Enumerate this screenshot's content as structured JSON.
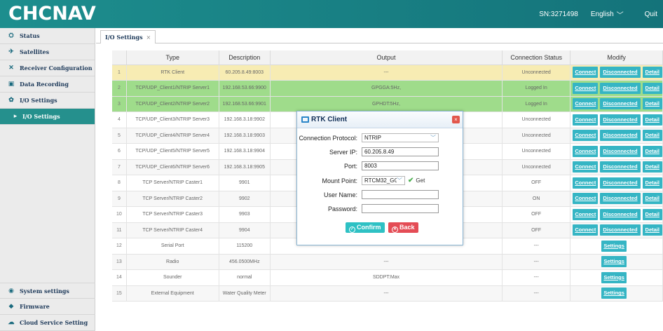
{
  "header": {
    "logo": "CHCNAV",
    "sn": "SN:3271498",
    "language": "English",
    "quit": "Quit",
    "colors": {
      "bar": "#1d8e8e"
    }
  },
  "sidebar": {
    "items": [
      {
        "label": "Status",
        "icon": "status-icon"
      },
      {
        "label": "Satellites",
        "icon": "satellite-icon"
      },
      {
        "label": "Receiver Configuration",
        "icon": "tools-icon"
      },
      {
        "label": "Data Recording",
        "icon": "recording-icon"
      },
      {
        "label": "I/O Settings",
        "icon": "gear-icon"
      },
      {
        "label": "I/O Settings",
        "icon": "arrow-right-icon",
        "active": true
      }
    ],
    "bottom_items": [
      {
        "label": "System settings",
        "icon": "wifi-icon"
      },
      {
        "label": "Firmware",
        "icon": "firmware-icon"
      },
      {
        "label": "Cloud Service Setting",
        "icon": "cloud-icon"
      }
    ]
  },
  "tabs": [
    {
      "label": "I/O Settings",
      "close": "×"
    }
  ],
  "table": {
    "headers": [
      "Type",
      "Description",
      "Output",
      "Connection Status",
      "Modify"
    ],
    "rows": [
      {
        "idx": "1",
        "type": "RTK Client",
        "desc": "60.205.8.49:8003",
        "output": "---",
        "status": "Unconnected",
        "style": "yellow",
        "buttons": [
          "Connect",
          "Disconnected",
          "Detail"
        ]
      },
      {
        "idx": "2",
        "type": "TCP/UDP_Client1/NTRIP Server1",
        "desc": "192.168.53.66:9900",
        "output": "GPGGA:5Hz,",
        "status": "Logged In",
        "style": "green",
        "buttons": [
          "Connect",
          "Disconnected",
          "Detail"
        ]
      },
      {
        "idx": "3",
        "type": "TCP/UDP_Client2/NTRIP Server2",
        "desc": "192.168.53.66:9901",
        "output": "GPHDT:5Hz,",
        "status": "Logged In",
        "style": "green",
        "buttons": [
          "Connect",
          "Disconnected",
          "Detail"
        ]
      },
      {
        "idx": "4",
        "type": "TCP/UDP_Client3/NTRIP Server3",
        "desc": "192.168.3.18:9902",
        "output": "",
        "status": "Unconnected",
        "style": "white",
        "buttons": [
          "Connect",
          "Disconnected",
          "Detail"
        ]
      },
      {
        "idx": "5",
        "type": "TCP/UDP_Client4/NTRIP Server4",
        "desc": "192.168.3.18:9903",
        "output": "",
        "status": "Unconnected",
        "style": "alt",
        "buttons": [
          "Connect",
          "Disconnected",
          "Detail"
        ]
      },
      {
        "idx": "6",
        "type": "TCP/UDP_Client5/NTRIP Server5",
        "desc": "192.168.3.18:9904",
        "output": "",
        "status": "Unconnected",
        "style": "white",
        "buttons": [
          "Connect",
          "Disconnected",
          "Detail"
        ]
      },
      {
        "idx": "7",
        "type": "TCP/UDP_Client6/NTRIP Server6",
        "desc": "192.168.3.18:9905",
        "output": "",
        "status": "Unconnected",
        "style": "alt",
        "buttons": [
          "Connect",
          "Disconnected",
          "Detail"
        ]
      },
      {
        "idx": "8",
        "type": "TCP Server/NTRIP Caster1",
        "desc": "9901",
        "output": "",
        "status": "OFF",
        "style": "white",
        "buttons": [
          "Connect",
          "Disconnected",
          "Detail"
        ]
      },
      {
        "idx": "9",
        "type": "TCP Server/NTRIP Caster2",
        "desc": "9902",
        "output": "",
        "status": "ON",
        "style": "alt",
        "buttons": [
          "Connect",
          "Disconnected",
          "Detail"
        ]
      },
      {
        "idx": "10",
        "type": "TCP Server/NTRIP Caster3",
        "desc": "9903",
        "output": "",
        "status": "OFF",
        "style": "white",
        "buttons": [
          "Connect",
          "Disconnected",
          "Detail"
        ]
      },
      {
        "idx": "11",
        "type": "TCP Server/NTRIP Caster4",
        "desc": "9904",
        "output": "",
        "status": "OFF",
        "style": "alt",
        "buttons": [
          "Connect",
          "Disconnected",
          "Detail"
        ]
      },
      {
        "idx": "12",
        "type": "Serial Port",
        "desc": "115200",
        "output": "",
        "status": "---",
        "style": "white",
        "buttons": [
          "Settings"
        ]
      },
      {
        "idx": "13",
        "type": "Radio",
        "desc": "456.0500MHz",
        "output": "---",
        "status": "---",
        "style": "alt",
        "buttons": [
          "Settings"
        ]
      },
      {
        "idx": "14",
        "type": "Sounder",
        "desc": "normal",
        "output": "SDDPT:Max",
        "status": "---",
        "style": "white",
        "buttons": [
          "Settings"
        ]
      },
      {
        "idx": "15",
        "type": "External Equipment",
        "desc": "Water Quality Meter",
        "output": "---",
        "status": "---",
        "style": "alt",
        "buttons": [
          "Settings"
        ]
      }
    ]
  },
  "modal": {
    "title": "RTK Client",
    "close": "×",
    "fields": {
      "protocol_label": "Connection Protocol:",
      "protocol_value": "NTRIP",
      "server_ip_label": "Server IP:",
      "server_ip_value": "60.205.8.49",
      "port_label": "Port:",
      "port_value": "8003",
      "mount_label": "Mount Point:",
      "mount_value": "RTCM32_GGB",
      "get_label": "Get",
      "user_label": "User Name:",
      "user_value": "",
      "password_label": "Password:",
      "password_value": ""
    },
    "confirm_label": "Confirm",
    "back_label": "Back"
  }
}
